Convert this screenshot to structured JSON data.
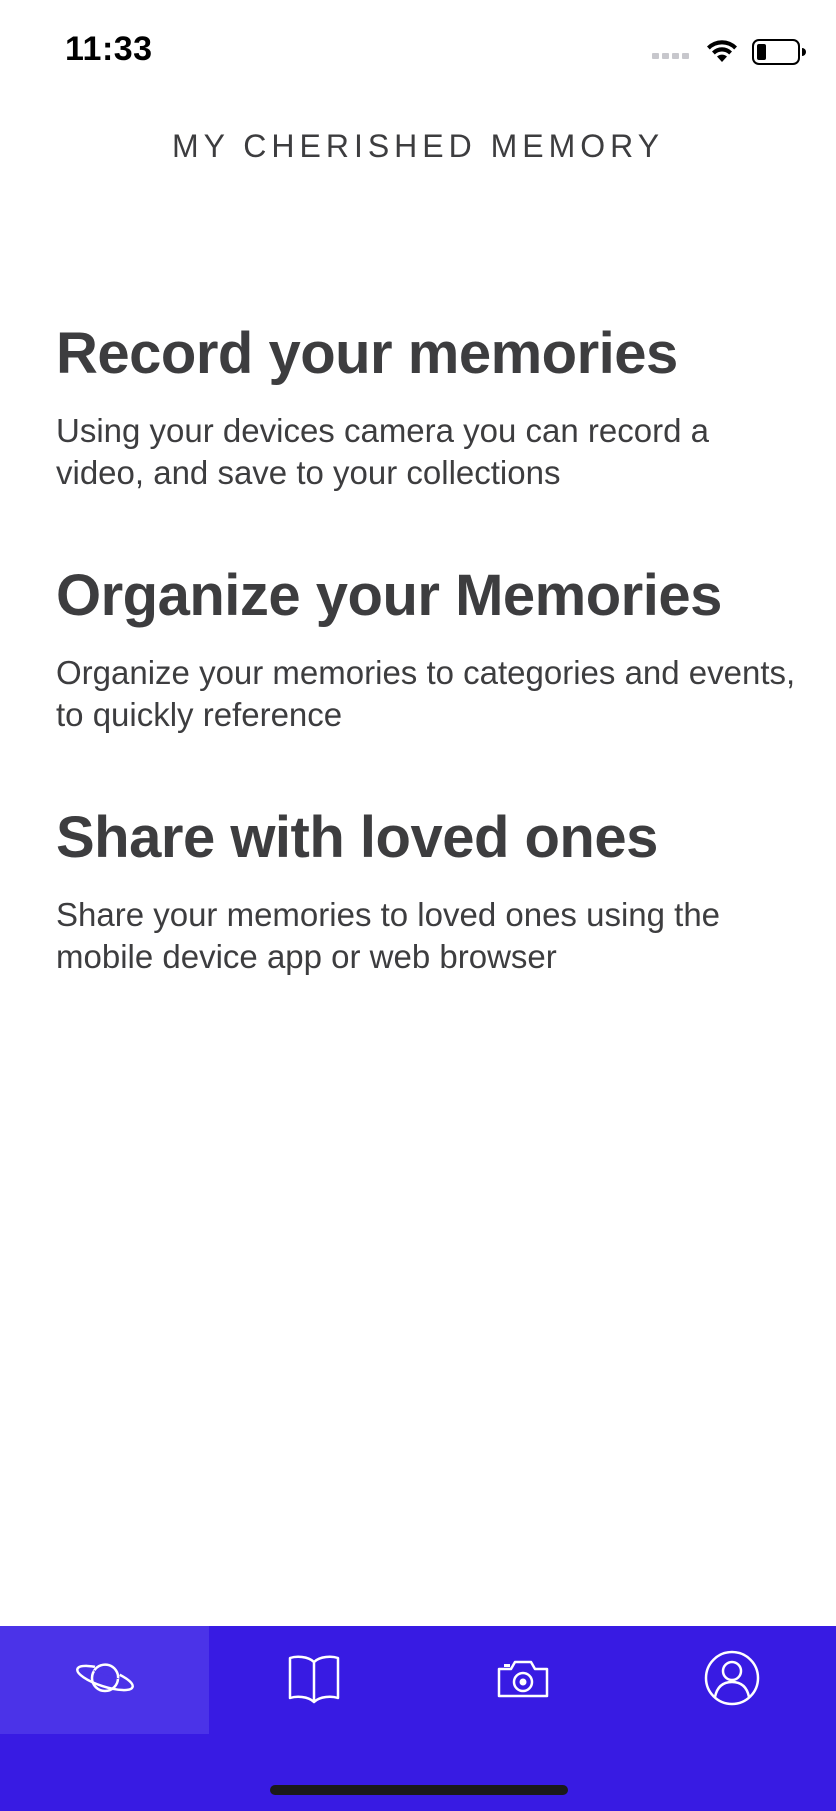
{
  "status_bar": {
    "time": "11:33"
  },
  "header": {
    "title": "MY CHERISHED MEMORY"
  },
  "features": [
    {
      "title": "Record your memories",
      "description": "Using your devices camera you can record a video, and save to your collections"
    },
    {
      "title": "Organize your Memories",
      "description": "Organize your memories to categories and events, to quickly reference"
    },
    {
      "title": "Share with loved ones",
      "description": "Share your memories to loved ones using the mobile device app or web browser"
    }
  ],
  "tab_bar": {
    "background_color": "#381be3",
    "active_tab_color": "#4b33e8",
    "tabs": [
      {
        "icon": "planet-icon",
        "active": true
      },
      {
        "icon": "book-icon",
        "active": false
      },
      {
        "icon": "camera-icon",
        "active": false
      },
      {
        "icon": "user-icon",
        "active": false
      }
    ]
  }
}
